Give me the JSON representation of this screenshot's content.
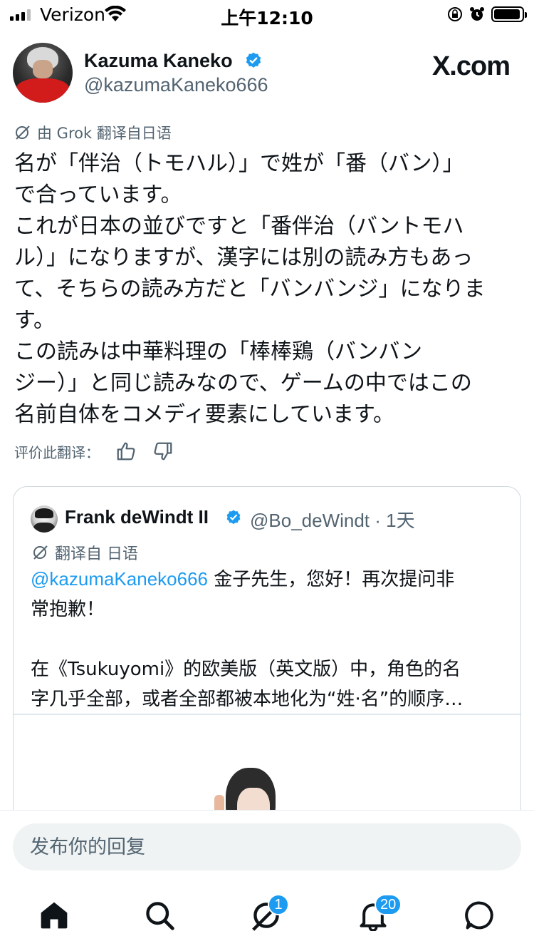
{
  "status_bar": {
    "carrier": "Verizon",
    "time": "上午12:10",
    "battery_level": 0.95
  },
  "header": {
    "author_name": "Kazuma Kaneko",
    "author_handle": "@kazumaKaneko666",
    "site_logo": "X.com",
    "verified": true,
    "accent_color": "#1d9bf0"
  },
  "tweet": {
    "translation_note": "由 Grok 翻译自日语",
    "lines": [
      "名が「伴治（トモハル）」で姓が「番（バン）」",
      "で合っています。",
      "これが日本の並びですと「番伴治（バントモハ",
      "ル）」になりますが、漢字には別の読み方もあっ",
      "て、そちらの読み方だと「バンバンジ」になりま",
      "す。",
      "この読みは中華料理の「棒棒鶏（バンバン",
      "ジー）」と同じ読みなので、ゲームの中ではこの",
      "名前自体をコメディ要素にしています。"
    ],
    "rate_label": "评价此翻译："
  },
  "quote": {
    "author_name": "Frank deWindt II",
    "author_handle": "@Bo_deWindt · 1天",
    "translation_note": "翻译自 日语",
    "mention": "@kazumaKaneko666",
    "line1_rest": " 金子先生，您好！再次提问非",
    "line2": "常抱歉！",
    "line3": "在《Tsukuyomi》的欧美版（英文版）中，角色的名",
    "line4": "字几乎全部，或者全部都被本地化为“姓·名”的顺序…"
  },
  "reply": {
    "placeholder": "发布你的回复"
  },
  "nav": {
    "grok_badge": "1",
    "notifications_badge": "20"
  }
}
